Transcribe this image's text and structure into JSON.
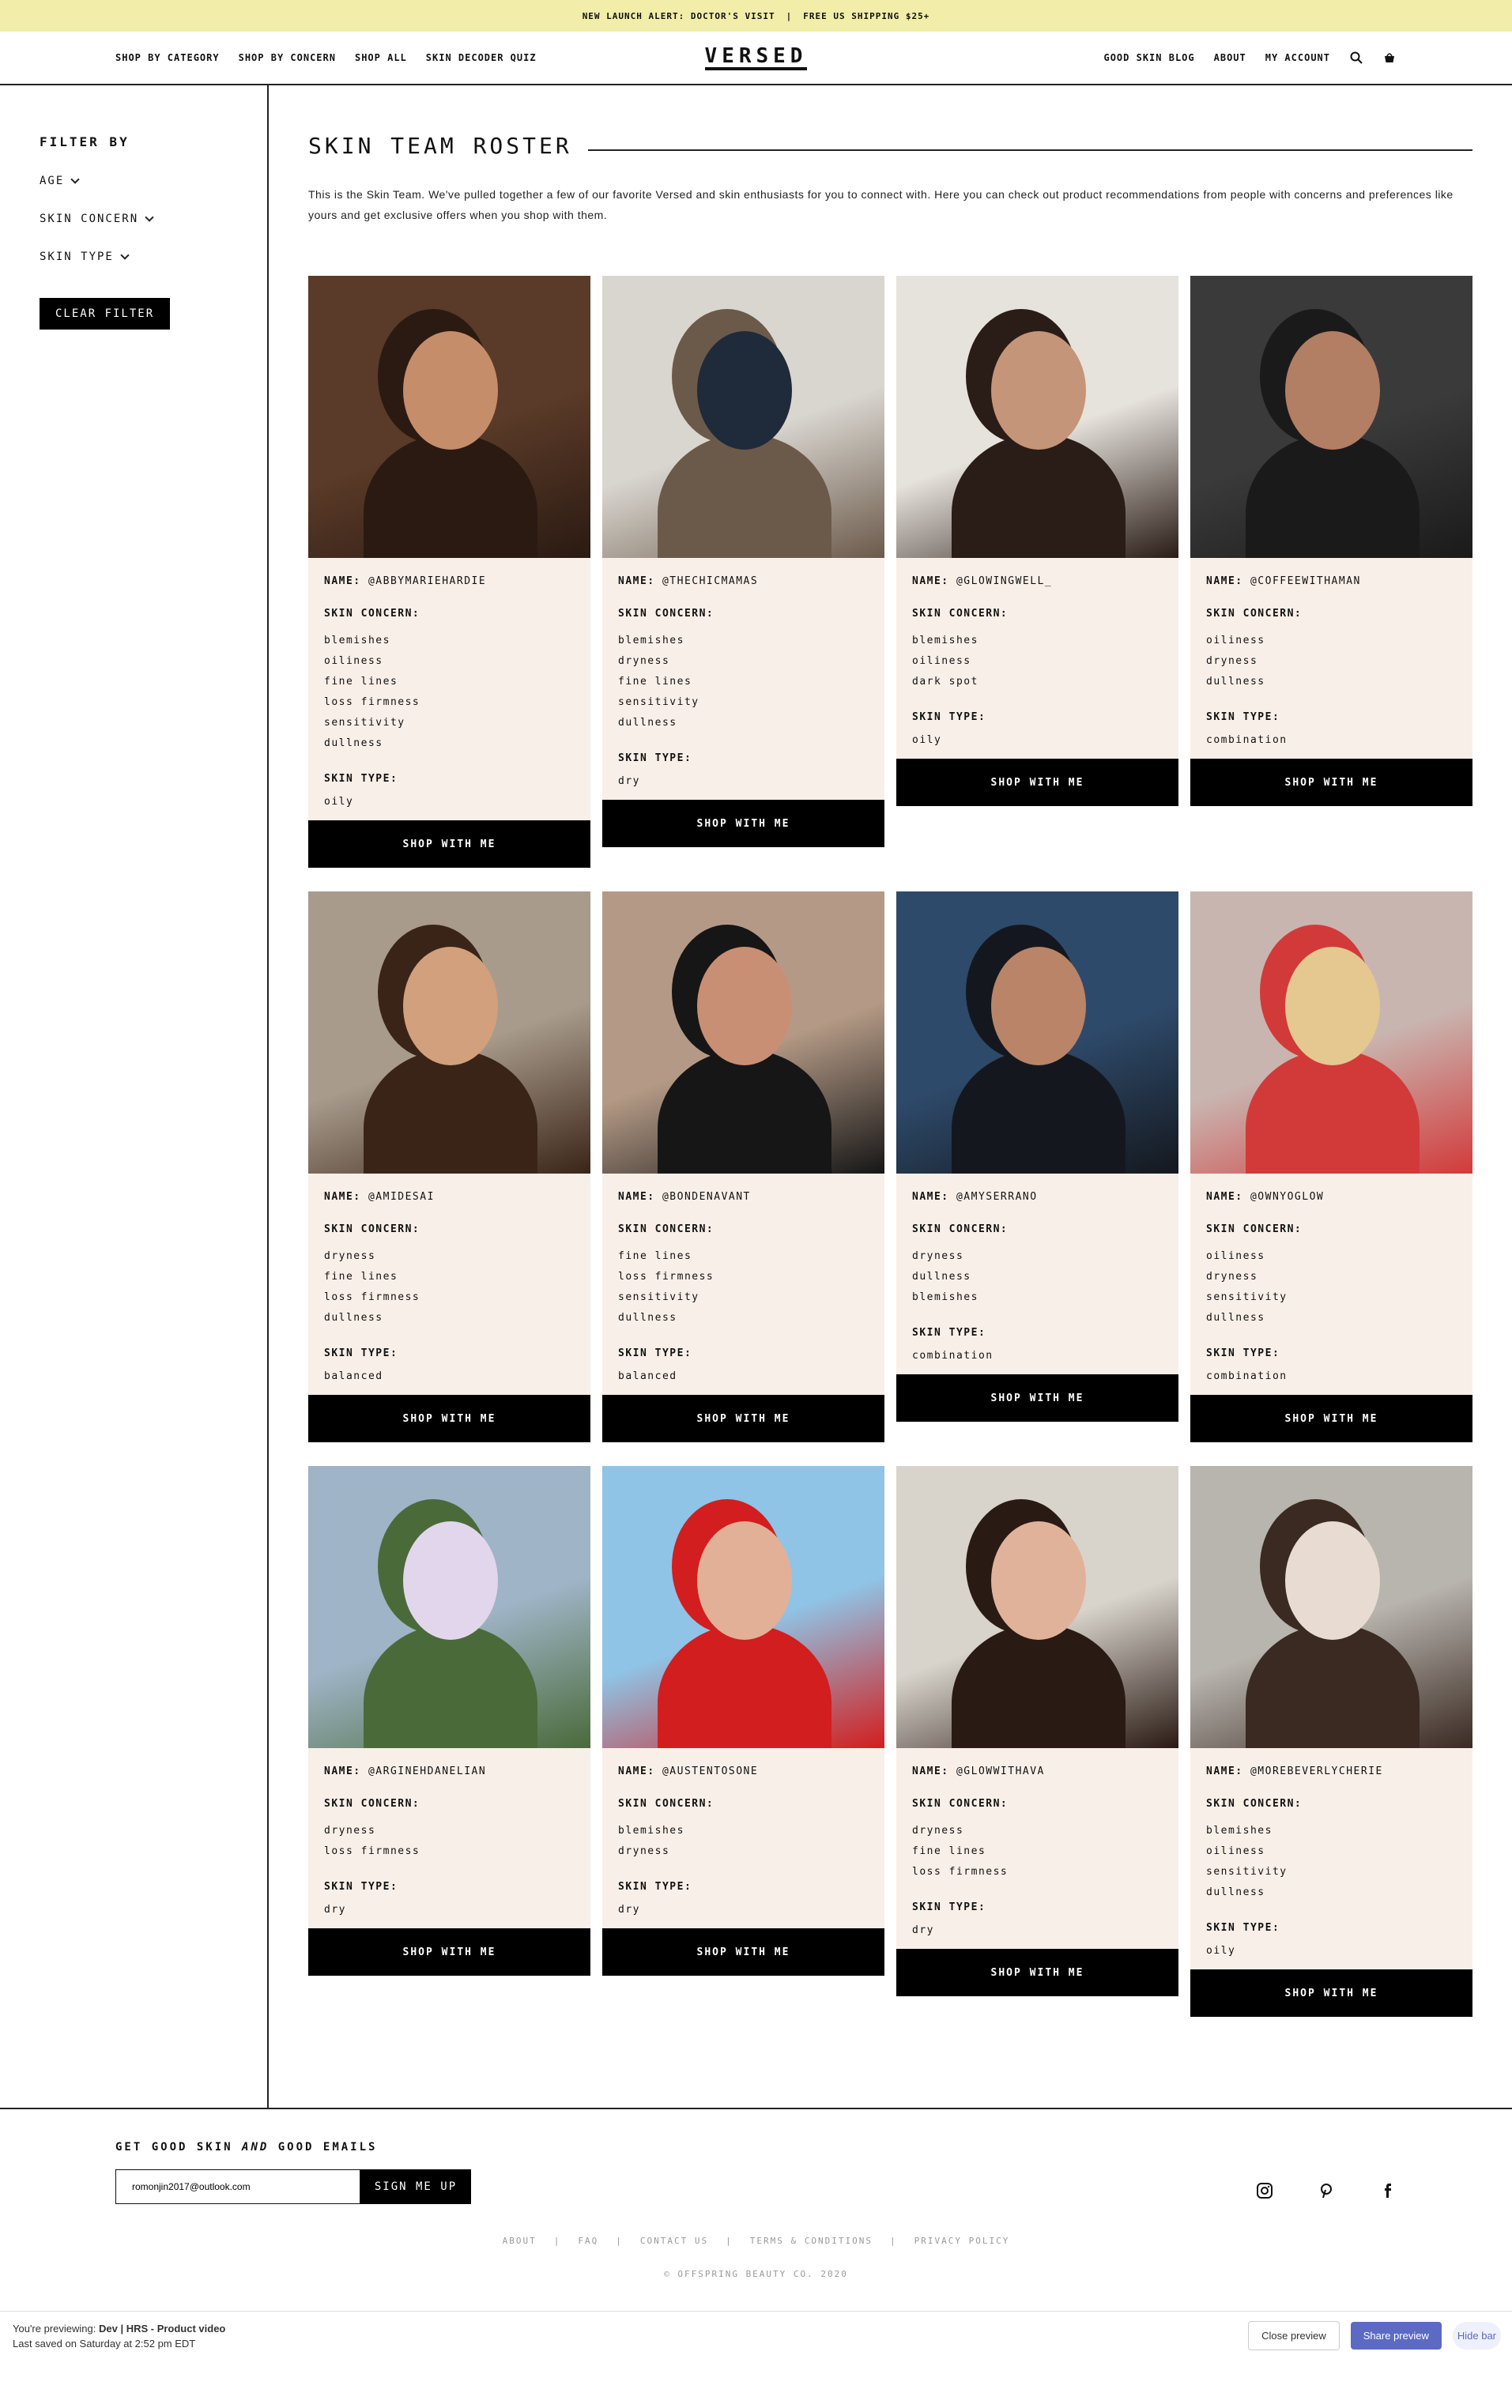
{
  "announcement": {
    "text_1": "NEW LAUNCH ALERT: DOCTOR'S VISIT",
    "separator": "|",
    "text_2": "FREE US SHIPPING $25+"
  },
  "header": {
    "nav_left": [
      "SHOP BY CATEGORY",
      "SHOP BY CONCERN",
      "SHOP ALL",
      "SKIN DECODER QUIZ"
    ],
    "logo": "VERSED",
    "nav_right": [
      "GOOD SKIN BLOG",
      "ABOUT",
      "MY ACCOUNT"
    ],
    "icons": [
      "search-icon",
      "cart-icon"
    ]
  },
  "sidebar": {
    "title": "FILTER BY",
    "filters": [
      "AGE",
      "SKIN CONCERN",
      "SKIN TYPE"
    ],
    "clear_label": "CLEAR FILTER"
  },
  "main": {
    "title": "SKIN TEAM ROSTER",
    "intro": "This is the Skin Team. We've pulled together a few of our favorite Versed and skin enthusiasts for you to connect with. Here you can check out product recommendations from people with concerns and preferences like yours and get exclusive offers when you shop with them."
  },
  "labels": {
    "name": "NAME:",
    "concern": "SKIN CONCERN:",
    "type": "SKIN TYPE:",
    "shop": "SHOP WITH ME"
  },
  "cards": [
    {
      "handle": "@ABBYMARIEHARDIE",
      "concerns": [
        "blemishes",
        "oiliness",
        "fine lines",
        "loss firmness",
        "sensitivity",
        "dullness"
      ],
      "skin_type": "oily",
      "photo_colors": [
        "#5a3a28",
        "#2a1a12",
        "#c58d6a"
      ]
    },
    {
      "handle": "@THECHICMAMAS",
      "concerns": [
        "blemishes",
        "dryness",
        "fine lines",
        "sensitivity",
        "dullness"
      ],
      "skin_type": "dry",
      "photo_colors": [
        "#d9d6d0",
        "#6b5a4a",
        "#1f2a3a"
      ]
    },
    {
      "handle": "@GLOWINGWELL_",
      "concerns": [
        "blemishes",
        "oiliness",
        "dark spot"
      ],
      "skin_type": "oily",
      "photo_colors": [
        "#e6e2dc",
        "#2a1c16",
        "#c49578"
      ]
    },
    {
      "handle": "@COFFEEWITHAMAN",
      "concerns": [
        "oiliness",
        "dryness",
        "dullness"
      ],
      "skin_type": "combination",
      "photo_colors": [
        "#3a3a3a",
        "#1a1a1a",
        "#b27e64"
      ]
    },
    {
      "handle": "@AMIDESAI",
      "concerns": [
        "dryness",
        "fine lines",
        "loss firmness",
        "dullness"
      ],
      "skin_type": "balanced",
      "photo_colors": [
        "#a89b8c",
        "#3a2418",
        "#d2a07c"
      ]
    },
    {
      "handle": "@BONDENAVANT",
      "concerns": [
        "fine lines",
        "loss firmness",
        "sensitivity",
        "dullness"
      ],
      "skin_type": "balanced",
      "photo_colors": [
        "#b49a86",
        "#161616",
        "#c98f74"
      ]
    },
    {
      "handle": "@AMYSERRANO",
      "concerns": [
        "dryness",
        "dullness",
        "blemishes"
      ],
      "skin_type": "combination",
      "photo_colors": [
        "#2e4a6a",
        "#14181e",
        "#b98468"
      ]
    },
    {
      "handle": "@OWNYOGLOW",
      "concerns": [
        "oiliness",
        "dryness",
        "sensitivity",
        "dullness"
      ],
      "skin_type": "combination",
      "photo_colors": [
        "#c9b5b0",
        "#d23a3a",
        "#e4c890"
      ]
    },
    {
      "handle": "@ARGINEHDANELIAN",
      "concerns": [
        "dryness",
        "loss firmness"
      ],
      "skin_type": "dry",
      "photo_colors": [
        "#9fb4c6",
        "#4a6a3a",
        "#e2d6ec"
      ]
    },
    {
      "handle": "@AUSTENTOSONE",
      "concerns": [
        "blemishes",
        "dryness"
      ],
      "skin_type": "dry",
      "photo_colors": [
        "#8fc4e6",
        "#d21e1e",
        "#e2b096"
      ]
    },
    {
      "handle": "@GLOWWITHAVA",
      "concerns": [
        "dryness",
        "fine lines",
        "loss firmness"
      ],
      "skin_type": "dry",
      "photo_colors": [
        "#d8d4cc",
        "#2a1a14",
        "#e0b29a"
      ]
    },
    {
      "handle": "@MOREBEVERLYCHERIE",
      "concerns": [
        "blemishes",
        "oiliness",
        "sensitivity",
        "dullness"
      ],
      "skin_type": "oily",
      "photo_colors": [
        "#b8b4ae",
        "#3a2a22",
        "#e8dcd2"
      ]
    }
  ],
  "footer": {
    "newsletter_title_1": "GET GOOD SKIN",
    "newsletter_title_em": "AND",
    "newsletter_title_2": "GOOD EMAILS",
    "email_value": "romonjin2017@outlook.com",
    "signup_label": "SIGN ME UP",
    "social": [
      "instagram-icon",
      "pinterest-icon",
      "facebook-icon"
    ],
    "links": [
      "ABOUT",
      "FAQ",
      "CONTACT US",
      "TERMS & CONDITIONS",
      "PRIVACY POLICY"
    ],
    "copyright": "© OFFSPRING BEAUTY CO. 2020"
  },
  "preview_bar": {
    "prefix": "You're previewing:",
    "theme": "Dev | HRS - Product video",
    "saved": "Last saved on Saturday at 2:52 pm EDT",
    "close_label": "Close preview",
    "share_label": "Share preview",
    "hide_label": "Hide bar"
  }
}
